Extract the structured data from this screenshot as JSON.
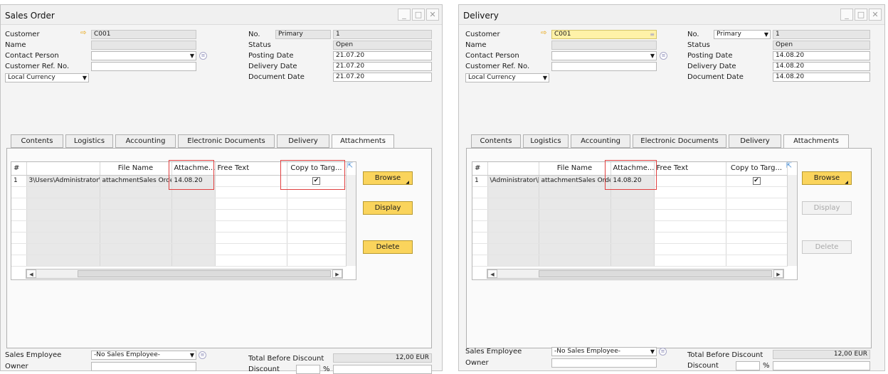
{
  "sales_order": {
    "title": "Sales Order",
    "customer_label": "Customer",
    "customer_value": "C001",
    "name_label": "Name",
    "contact_label": "Contact Person",
    "ref_label": "Customer Ref. No.",
    "currency_value": "Local Currency",
    "no_label": "No.",
    "no_series": "Primary",
    "no_value": "1",
    "status_label": "Status",
    "status_value": "Open",
    "posting_label": "Posting Date",
    "posting_value": "21.07.20",
    "delivery_label": "Delivery Date",
    "delivery_value": "21.07.20",
    "document_label": "Document Date",
    "document_value": "21.07.20",
    "tabs": [
      "Contents",
      "Logistics",
      "Accounting",
      "Electronic Documents",
      "Delivery",
      "Attachments"
    ],
    "grid_headers": [
      "#",
      "",
      "File Name",
      "Attachme...",
      "Free Text",
      "Copy to Targ..."
    ],
    "row": {
      "num": "1",
      "path": "3\\Users\\Administrator\\[",
      "file": "attachmentSales Orde",
      "date": "14.08.20"
    },
    "browse": "Browse",
    "display": "Display",
    "delete": "Delete",
    "sales_emp_label": "Sales Employee",
    "sales_emp_value": "-No Sales Employee-",
    "owner_label": "Owner",
    "total_label": "Total Before Discount",
    "total_value": "12,00 EUR",
    "discount_label": "Discount",
    "percent": "%"
  },
  "delivery": {
    "title": "Delivery",
    "customer_label": "Customer",
    "customer_value": "C001",
    "name_label": "Name",
    "contact_label": "Contact Person",
    "ref_label": "Customer Ref. No.",
    "currency_value": "Local Currency",
    "no_label": "No.",
    "no_series": "Primary",
    "no_value": "1",
    "status_label": "Status",
    "status_value": "Open",
    "posting_label": "Posting Date",
    "posting_value": "14.08.20",
    "delivery_label": "Delivery Date",
    "delivery_value": "14.08.20",
    "document_label": "Document Date",
    "document_value": "14.08.20",
    "tabs": [
      "Contents",
      "Logistics",
      "Accounting",
      "Electronic Documents",
      "Delivery",
      "Attachments"
    ],
    "grid_headers": [
      "#",
      "",
      "File Name",
      "Attachme...",
      "Free Text",
      "Copy to Targ..."
    ],
    "row": {
      "num": "1",
      "path": "\\Administrator\\[",
      "file": "attachmentSales Orde",
      "date": "14.08.20"
    },
    "browse": "Browse",
    "display": "Display",
    "delete": "Delete",
    "sales_emp_label": "Sales Employee",
    "sales_emp_value": "-No Sales Employee-",
    "owner_label": "Owner",
    "total_label": "Total Before Discount",
    "total_value": "12,00 EUR",
    "discount_label": "Discount",
    "percent": "%"
  },
  "window_controls": {
    "minimize": "_",
    "maximize": "□",
    "close": "✕"
  },
  "colors": {
    "button_yellow": "#fad45c",
    "highlight_red": "#e04040",
    "customer_yellow": "#fff2a8"
  }
}
